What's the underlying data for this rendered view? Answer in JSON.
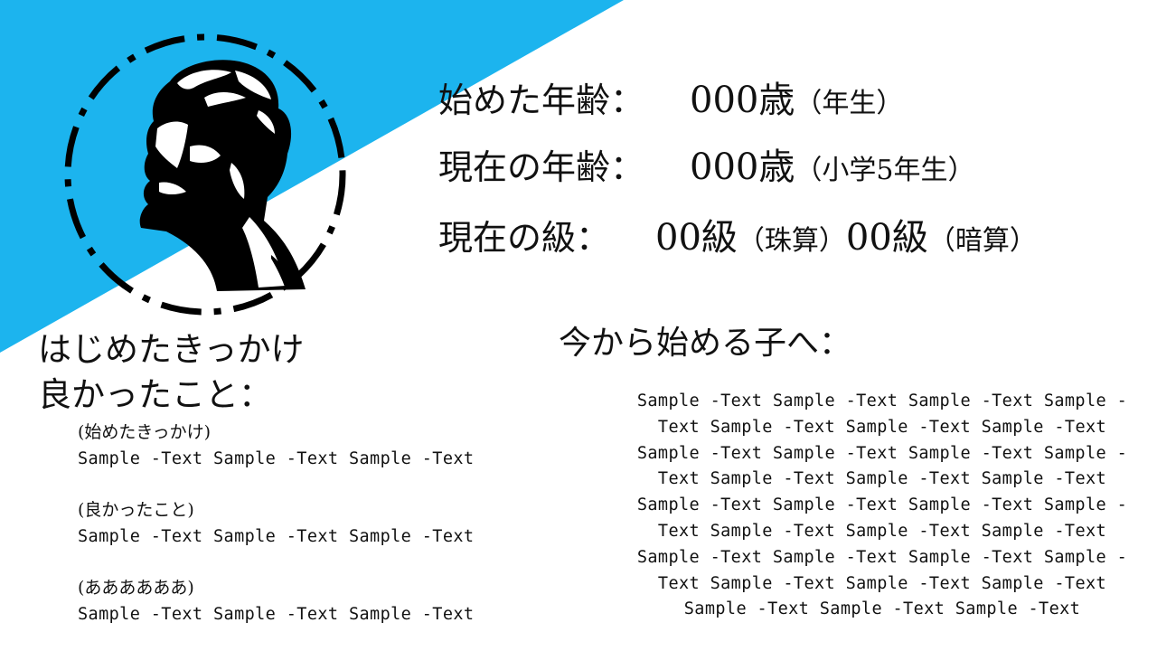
{
  "colors": {
    "accent": "#1cb4ee",
    "text": "#111111"
  },
  "stats": {
    "start_age": {
      "label": "始めた年齢：",
      "value": "000歳",
      "note": "（年生）"
    },
    "current_age": {
      "label": "現在の年齢：",
      "value": "000歳",
      "note": "（小学5年生）"
    },
    "grade": {
      "label": "現在の級：",
      "abacus_value": "00級",
      "abacus_note": "（珠算）",
      "mental_value": "00級",
      "mental_note": "（暗算）"
    }
  },
  "left": {
    "heading": "はじめたきっかけ\n良かったこと：",
    "blocks": [
      {
        "subtitle": "(始めたきっかけ)",
        "text": "Sample -Text Sample -Text Sample -Text"
      },
      {
        "subtitle": "(良かったこと)",
        "text": "Sample -Text Sample -Text Sample -Text"
      },
      {
        "subtitle": "(ああああああ)",
        "text": "Sample -Text Sample -Text Sample -Text"
      }
    ]
  },
  "right": {
    "heading": "今から始める子へ：",
    "text": "Sample -Text Sample -Text Sample -Text Sample -\nText Sample -Text Sample -Text Sample -Text\nSample -Text Sample -Text Sample -Text Sample -\nText Sample -Text Sample -Text Sample -Text\nSample -Text Sample -Text Sample -Text Sample -\nText Sample -Text Sample -Text Sample -Text\nSample -Text Sample -Text Sample -Text Sample -\nText Sample -Text Sample -Text Sample -Text\nSample -Text Sample -Text Sample -Text"
  }
}
